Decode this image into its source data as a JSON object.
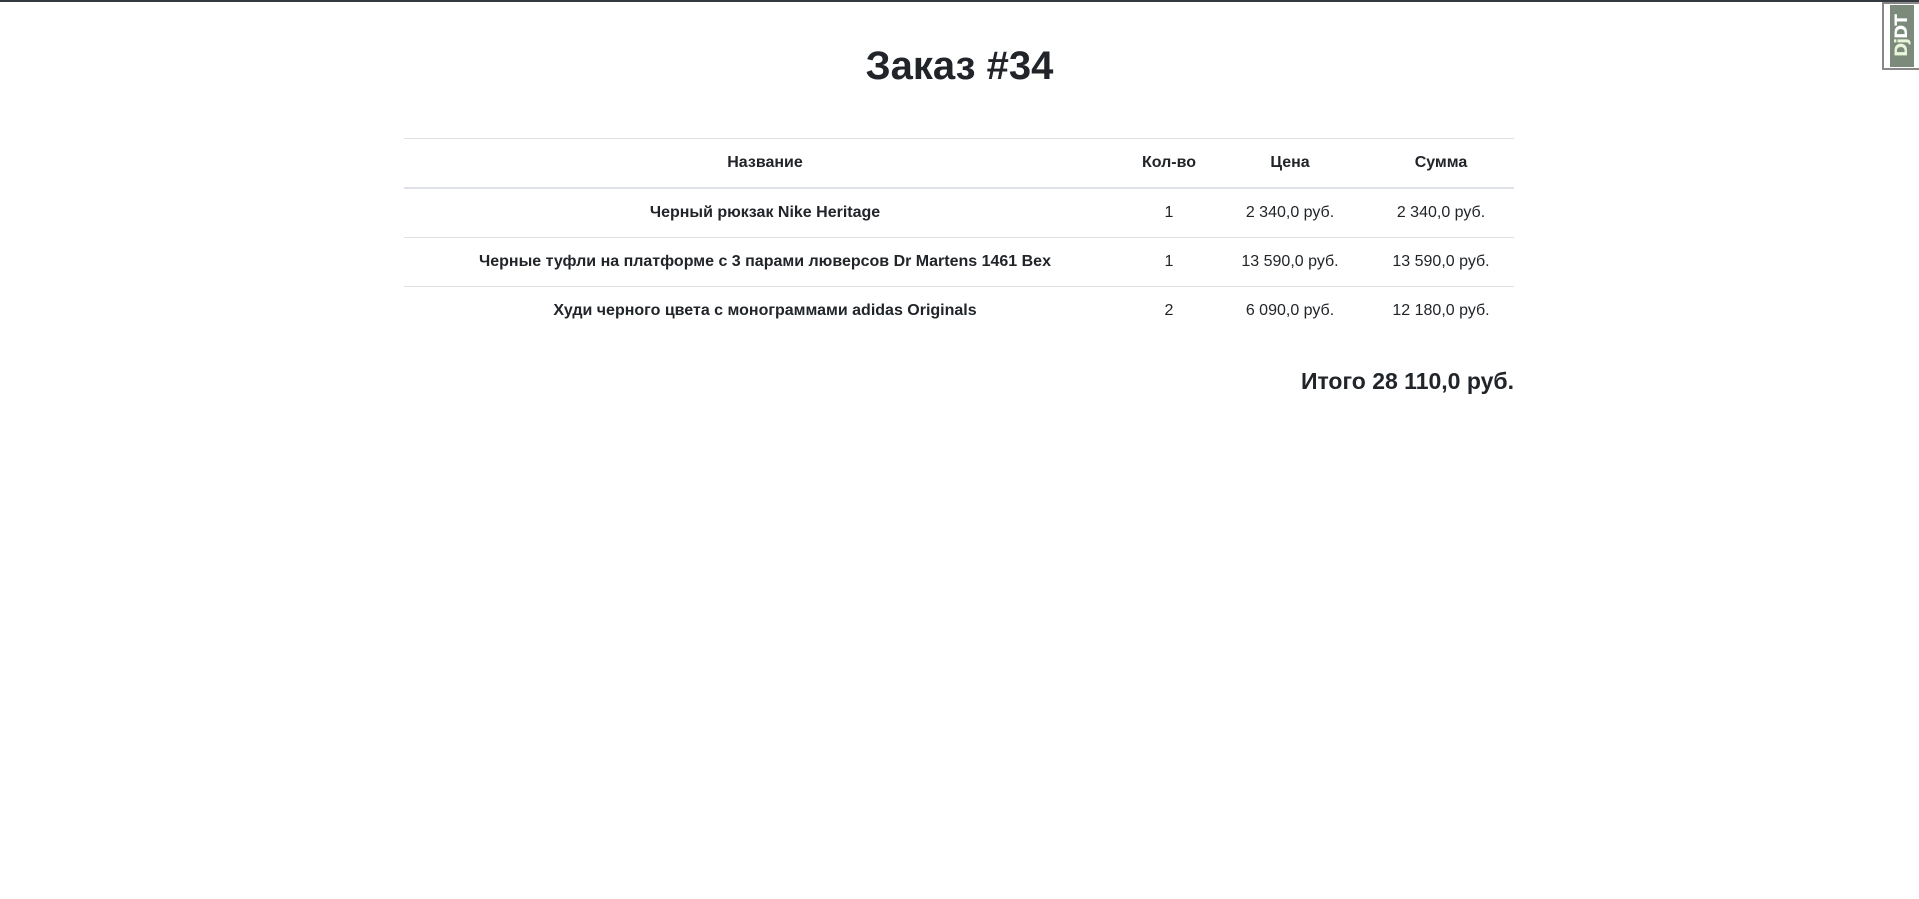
{
  "order": {
    "title": "Заказ #34"
  },
  "table": {
    "headers": {
      "name": "Название",
      "qty": "Кол-во",
      "price": "Цена",
      "sum": "Сумма"
    },
    "rows": [
      {
        "name": "Черный рюкзак Nike Heritage",
        "qty": "1",
        "price": "2 340,0 руб.",
        "sum": "2 340,0 руб."
      },
      {
        "name": "Черные туфли на платформе с 3 парами люверсов Dr Martens 1461 Bex",
        "qty": "1",
        "price": "13 590,0 руб.",
        "sum": "13 590,0 руб."
      },
      {
        "name": "Худи черного цвета с монограммами adidas Originals",
        "qty": "2",
        "price": "6 090,0 руб.",
        "sum": "12 180,0 руб."
      }
    ]
  },
  "total": {
    "label": "Итого",
    "value": "28 110,0 руб."
  },
  "debug_toolbar": {
    "label_dj": "Dj",
    "label_dt": "DT",
    "icon": "django-debug-toolbar-icon"
  }
}
